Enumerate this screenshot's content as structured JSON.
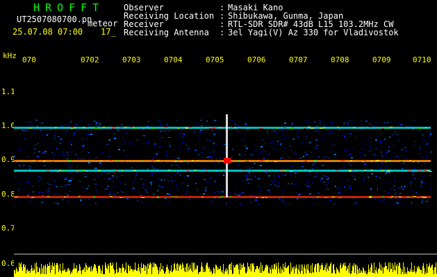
{
  "header": {
    "app_title": "HROFFT",
    "file_name": "UT2507080700.pn",
    "meteor_label": "meteor",
    "date_time": "25.07.08 07:00",
    "counter": "17_"
  },
  "metadata": [
    {
      "label": "Observer",
      "separator": ":",
      "value": "Masaki Kano"
    },
    {
      "label": "Receiving Location",
      "separator": ":",
      "value": "Shibukawa, Gunma, Japan"
    },
    {
      "label": "Receiver",
      "separator": ":",
      "value": "RTL-SDR SDR# 43dB L15 103.2MHz CW"
    },
    {
      "label": "Receiving Antenna",
      "separator": ":",
      "value": "3el Yagi(V) Az 330 for Vladivostok"
    }
  ],
  "axes": {
    "frequency_unit": "kHz",
    "frequency_ticks": [
      "1.1",
      "1.0",
      "0.9",
      "0.8",
      "0.7",
      "0.6"
    ],
    "time_ticks": [
      "070",
      "0702",
      "0703",
      "0704",
      "0705",
      "0706",
      "0707",
      "0708",
      "0709",
      "0710"
    ]
  },
  "spectrogram": {
    "visible_bands_khz": [
      1.0,
      0.9,
      0.87,
      0.8
    ],
    "burst_time_label": "0705"
  },
  "colors": {
    "background": "#000000",
    "text_primary": "#ffffff",
    "text_title": "#00ff00",
    "text_axis": "#ffff00",
    "spectrum_noise": "#0000ff",
    "spectrum_line": "#00ffff",
    "spectrum_peak": "#ff0000",
    "histogram": "#ffff00"
  }
}
